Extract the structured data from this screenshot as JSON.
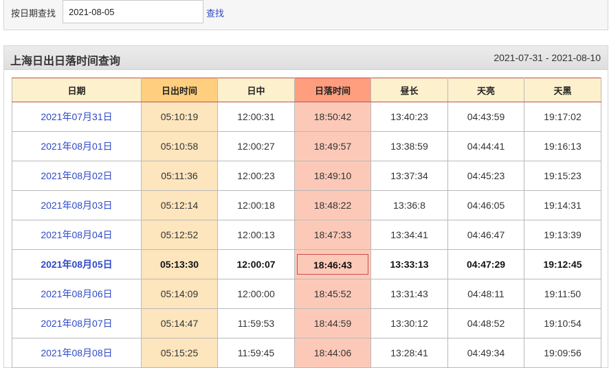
{
  "search": {
    "label": "按日期查找",
    "value": "2021-08-05",
    "button": "查找"
  },
  "panel": {
    "title": "上海日出日落时间查询",
    "range": "2021-07-31 - 2021-08-10"
  },
  "table": {
    "headers": [
      "日期",
      "日出时间",
      "日中",
      "日落时间",
      "昼长",
      "天亮",
      "天黑"
    ],
    "rows": [
      [
        "2021年07月31日",
        "05:10:19",
        "12:00:31",
        "18:50:42",
        "13:40:23",
        "04:43:59",
        "19:17:02"
      ],
      [
        "2021年08月01日",
        "05:10:58",
        "12:00:27",
        "18:49:57",
        "13:38:59",
        "04:44:41",
        "19:16:13"
      ],
      [
        "2021年08月02日",
        "05:11:36",
        "12:00:23",
        "18:49:10",
        "13:37:34",
        "04:45:23",
        "19:15:23"
      ],
      [
        "2021年08月03日",
        "05:12:14",
        "12:00:18",
        "18:48:22",
        "13:36:8",
        "04:46:05",
        "19:14:31"
      ],
      [
        "2021年08月04日",
        "05:12:52",
        "12:00:13",
        "18:47:33",
        "13:34:41",
        "04:46:47",
        "19:13:39"
      ],
      [
        "2021年08月05日",
        "05:13:30",
        "12:00:07",
        "18:46:43",
        "13:33:13",
        "04:47:29",
        "19:12:45"
      ],
      [
        "2021年08月06日",
        "05:14:09",
        "12:00:00",
        "18:45:52",
        "13:31:43",
        "04:48:11",
        "19:11:50"
      ],
      [
        "2021年08月07日",
        "05:14:47",
        "11:59:53",
        "18:44:59",
        "13:30:12",
        "04:48:52",
        "19:10:54"
      ],
      [
        "2021年08月08日",
        "05:15:25",
        "11:59:45",
        "18:44:06",
        "13:28:41",
        "04:49:34",
        "19:09:56"
      ]
    ],
    "current_row": 5
  }
}
